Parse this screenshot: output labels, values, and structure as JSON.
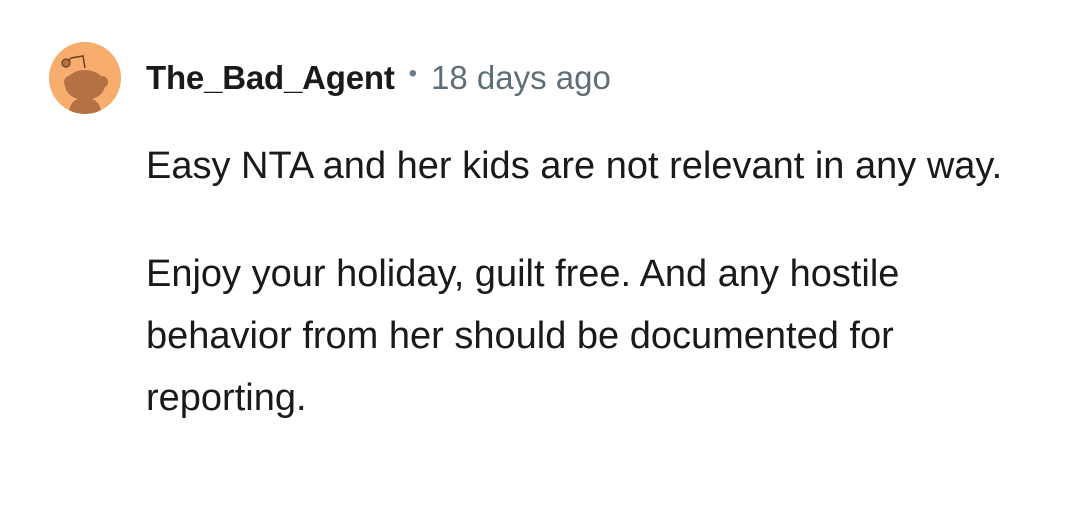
{
  "comment": {
    "author": "The_Bad_Agent",
    "separator": "•",
    "timestamp": "18 days ago",
    "avatar": {
      "icon": "snoo-avatar-icon",
      "background": "#f6ad6d",
      "figure_color": "#b57043"
    },
    "paragraphs": [
      "Easy NTA and her kids are not relevant in any way.",
      "Enjoy your holiday, guilt free. And any hostile behavior from her should be documented for reporting."
    ]
  }
}
